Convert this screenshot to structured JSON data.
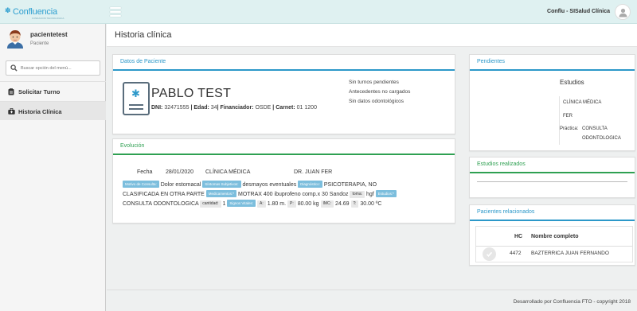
{
  "app": {
    "logo_text": "Confluencia",
    "logo_tagline": "FUNDACION TECNOLOGICA",
    "title": "Conflu - SISalud Clínica"
  },
  "user": {
    "name": "pacientetest",
    "role": "Paciente"
  },
  "search": {
    "placeholder": "Buscar opción del menú..."
  },
  "nav": [
    {
      "label": "Solicitar Turno",
      "icon": "clipboard-icon"
    },
    {
      "label": "Historia Clínica",
      "icon": "briefcase-icon"
    }
  ],
  "page": {
    "title": "Historia clínica"
  },
  "patient_panel": {
    "header": "Datos de Paciente",
    "name": "PABLO TEST",
    "dni_label": "DNI:",
    "dni": "32471555",
    "edad_label": "Edad:",
    "edad": "34",
    "financiador_label": "Financiador:",
    "financiador": "OSDE",
    "carnet_label": "Carnet:",
    "carnet": "01 1200",
    "status": [
      "Sin turnos pendientes",
      "Antecedentes no cargados",
      "Sin datos odontológicos"
    ]
  },
  "evolucion": {
    "header": "Evolución",
    "fecha_label": "Fecha",
    "fecha": "28/01/2020",
    "especialidad": "CLÍNICA MÉDICA",
    "doctor": "DR. JUAN FER",
    "motivo_label": "Motivo de Consulta:",
    "motivo": "Dolor estomacal",
    "sintomas_label": "Síntomas Subjetivos:",
    "sintomas": "desmayos eventuales",
    "diagnostico_label": "Diagnóstico:",
    "diagnostico_a": "PSICOTERAPIA, NO",
    "diagnostico_b": "CLASIFICADA EN OTRA PARTE",
    "medicamentos_label": "Medicamentos:*",
    "medicamentos": "MOTRAX 400 ibuprofeno comp.x 30 Sandoz",
    "toma_label": "toma:",
    "toma": "hgf",
    "estudios_label": "Estudios:*",
    "estudios": "CONSULTA ODONTOLOGICA",
    "cantidad_label": "cantidad:",
    "cantidad": "1",
    "signos_label": "Signos Vitales:",
    "a_label": "A:",
    "a": "1.80 m.",
    "p_label": "P:",
    "p": "80.00 kg",
    "imc_label": "IMC:",
    "imc": "24.69",
    "t_label": "T:",
    "t": "30.00 ºC"
  },
  "pendientes": {
    "header": "Pendientes",
    "estudios_title": "Estudios",
    "items": [
      "CLÍNICA MÉDICA",
      "FER",
      "Práctica:",
      "CONSULTA",
      "ODONTOLOGICA"
    ]
  },
  "estudios_realizados": {
    "header": "Estudios realizados"
  },
  "pacientes_relacionados": {
    "header": "Pacientes relacionados",
    "col_hc": "HC",
    "col_nombre": "Nombre completo",
    "rows": [
      {
        "hc": "4472",
        "nombre": "BAZTERRICA JUAN FERNANDO"
      }
    ]
  },
  "footer": {
    "text": "Desarrollado por Confluencia FTO - copyright 2018"
  },
  "colors": {
    "accent_blue": "#2c98c9",
    "accent_green": "#2fa052",
    "topbar": "#dff1f1"
  }
}
